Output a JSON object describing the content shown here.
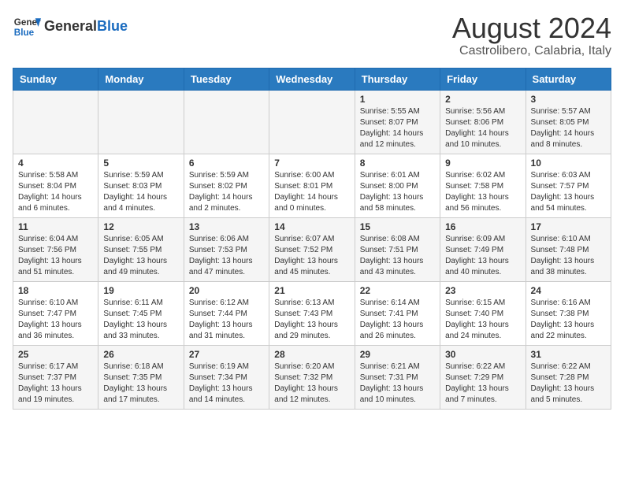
{
  "header": {
    "logo_general": "General",
    "logo_blue": "Blue",
    "month_title": "August 2024",
    "location": "Castrolibero, Calabria, Italy"
  },
  "days_of_week": [
    "Sunday",
    "Monday",
    "Tuesday",
    "Wednesday",
    "Thursday",
    "Friday",
    "Saturday"
  ],
  "weeks": [
    [
      {
        "day": "",
        "info": ""
      },
      {
        "day": "",
        "info": ""
      },
      {
        "day": "",
        "info": ""
      },
      {
        "day": "",
        "info": ""
      },
      {
        "day": "1",
        "info": "Sunrise: 5:55 AM\nSunset: 8:07 PM\nDaylight: 14 hours\nand 12 minutes."
      },
      {
        "day": "2",
        "info": "Sunrise: 5:56 AM\nSunset: 8:06 PM\nDaylight: 14 hours\nand 10 minutes."
      },
      {
        "day": "3",
        "info": "Sunrise: 5:57 AM\nSunset: 8:05 PM\nDaylight: 14 hours\nand 8 minutes."
      }
    ],
    [
      {
        "day": "4",
        "info": "Sunrise: 5:58 AM\nSunset: 8:04 PM\nDaylight: 14 hours\nand 6 minutes."
      },
      {
        "day": "5",
        "info": "Sunrise: 5:59 AM\nSunset: 8:03 PM\nDaylight: 14 hours\nand 4 minutes."
      },
      {
        "day": "6",
        "info": "Sunrise: 5:59 AM\nSunset: 8:02 PM\nDaylight: 14 hours\nand 2 minutes."
      },
      {
        "day": "7",
        "info": "Sunrise: 6:00 AM\nSunset: 8:01 PM\nDaylight: 14 hours\nand 0 minutes."
      },
      {
        "day": "8",
        "info": "Sunrise: 6:01 AM\nSunset: 8:00 PM\nDaylight: 13 hours\nand 58 minutes."
      },
      {
        "day": "9",
        "info": "Sunrise: 6:02 AM\nSunset: 7:58 PM\nDaylight: 13 hours\nand 56 minutes."
      },
      {
        "day": "10",
        "info": "Sunrise: 6:03 AM\nSunset: 7:57 PM\nDaylight: 13 hours\nand 54 minutes."
      }
    ],
    [
      {
        "day": "11",
        "info": "Sunrise: 6:04 AM\nSunset: 7:56 PM\nDaylight: 13 hours\nand 51 minutes."
      },
      {
        "day": "12",
        "info": "Sunrise: 6:05 AM\nSunset: 7:55 PM\nDaylight: 13 hours\nand 49 minutes."
      },
      {
        "day": "13",
        "info": "Sunrise: 6:06 AM\nSunset: 7:53 PM\nDaylight: 13 hours\nand 47 minutes."
      },
      {
        "day": "14",
        "info": "Sunrise: 6:07 AM\nSunset: 7:52 PM\nDaylight: 13 hours\nand 45 minutes."
      },
      {
        "day": "15",
        "info": "Sunrise: 6:08 AM\nSunset: 7:51 PM\nDaylight: 13 hours\nand 43 minutes."
      },
      {
        "day": "16",
        "info": "Sunrise: 6:09 AM\nSunset: 7:49 PM\nDaylight: 13 hours\nand 40 minutes."
      },
      {
        "day": "17",
        "info": "Sunrise: 6:10 AM\nSunset: 7:48 PM\nDaylight: 13 hours\nand 38 minutes."
      }
    ],
    [
      {
        "day": "18",
        "info": "Sunrise: 6:10 AM\nSunset: 7:47 PM\nDaylight: 13 hours\nand 36 minutes."
      },
      {
        "day": "19",
        "info": "Sunrise: 6:11 AM\nSunset: 7:45 PM\nDaylight: 13 hours\nand 33 minutes."
      },
      {
        "day": "20",
        "info": "Sunrise: 6:12 AM\nSunset: 7:44 PM\nDaylight: 13 hours\nand 31 minutes."
      },
      {
        "day": "21",
        "info": "Sunrise: 6:13 AM\nSunset: 7:43 PM\nDaylight: 13 hours\nand 29 minutes."
      },
      {
        "day": "22",
        "info": "Sunrise: 6:14 AM\nSunset: 7:41 PM\nDaylight: 13 hours\nand 26 minutes."
      },
      {
        "day": "23",
        "info": "Sunrise: 6:15 AM\nSunset: 7:40 PM\nDaylight: 13 hours\nand 24 minutes."
      },
      {
        "day": "24",
        "info": "Sunrise: 6:16 AM\nSunset: 7:38 PM\nDaylight: 13 hours\nand 22 minutes."
      }
    ],
    [
      {
        "day": "25",
        "info": "Sunrise: 6:17 AM\nSunset: 7:37 PM\nDaylight: 13 hours\nand 19 minutes."
      },
      {
        "day": "26",
        "info": "Sunrise: 6:18 AM\nSunset: 7:35 PM\nDaylight: 13 hours\nand 17 minutes."
      },
      {
        "day": "27",
        "info": "Sunrise: 6:19 AM\nSunset: 7:34 PM\nDaylight: 13 hours\nand 14 minutes."
      },
      {
        "day": "28",
        "info": "Sunrise: 6:20 AM\nSunset: 7:32 PM\nDaylight: 13 hours\nand 12 minutes."
      },
      {
        "day": "29",
        "info": "Sunrise: 6:21 AM\nSunset: 7:31 PM\nDaylight: 13 hours\nand 10 minutes."
      },
      {
        "day": "30",
        "info": "Sunrise: 6:22 AM\nSunset: 7:29 PM\nDaylight: 13 hours\nand 7 minutes."
      },
      {
        "day": "31",
        "info": "Sunrise: 6:22 AM\nSunset: 7:28 PM\nDaylight: 13 hours\nand 5 minutes."
      }
    ]
  ]
}
